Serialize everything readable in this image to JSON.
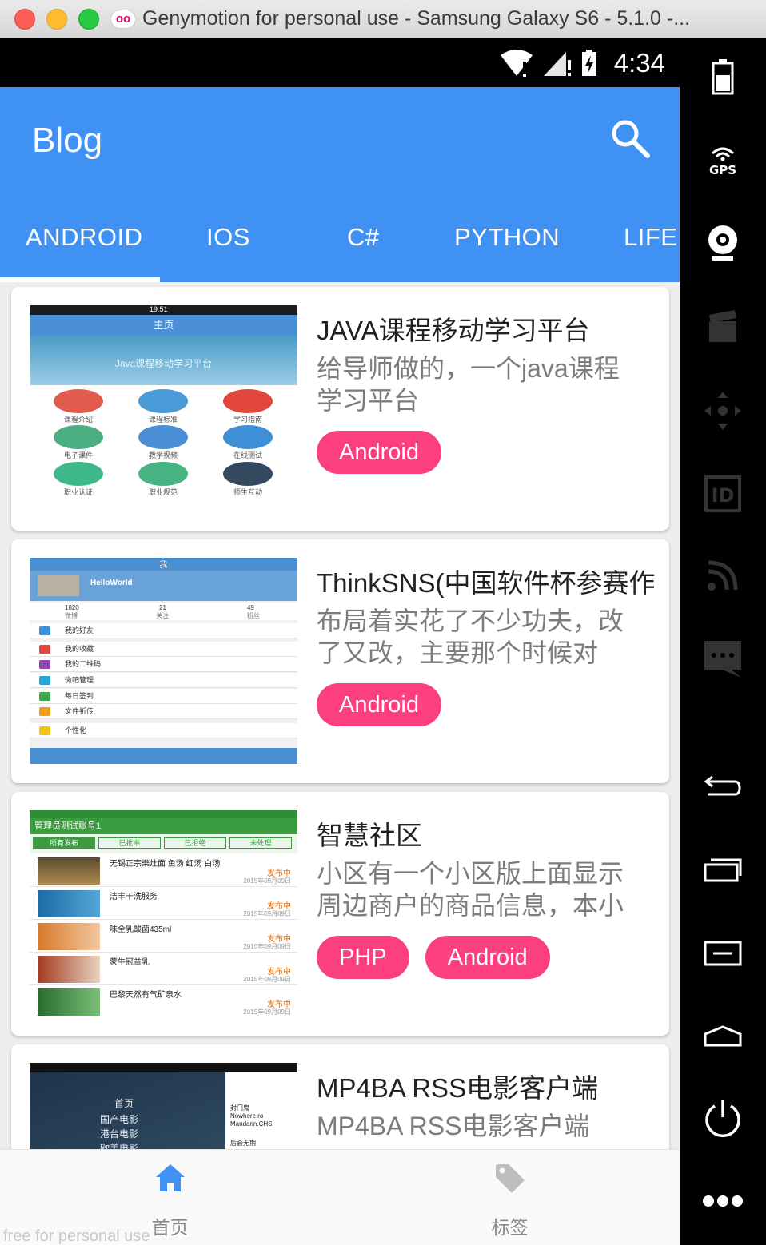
{
  "window": {
    "title": "Genymotion for personal use - Samsung Galaxy S6 - 5.1.0 -..."
  },
  "status_bar": {
    "time": "4:34"
  },
  "app_bar": {
    "title": "Blog"
  },
  "tabs": [
    {
      "label": "ANDROID",
      "selected": true
    },
    {
      "label": "IOS"
    },
    {
      "label": "C#"
    },
    {
      "label": "PYTHON"
    },
    {
      "label": "LIFE"
    }
  ],
  "posts": [
    {
      "title": "JAVA课程移动学习平台",
      "desc": "给导师做的，一个java课程学习平台",
      "tags": [
        "Android"
      ],
      "thumb": {
        "time": "19:51",
        "bar": "主页",
        "banner": "Java课程移动学习平台",
        "items": [
          "课程介绍",
          "课程标准",
          "学习指南",
          "电子课件",
          "教学视频",
          "在线测试",
          "职业认证",
          "职业规范",
          "师生互动"
        ]
      }
    },
    {
      "title": "ThinkSNS(中国软件杯参赛作",
      "desc": "布局着实花了不少功夫，改了又改，主要那个时候对",
      "tags": [
        "Android"
      ],
      "thumb": {
        "top": "我",
        "user": "HelloWorld",
        "stats": [
          "1820",
          "21",
          "49"
        ],
        "stat_labels": [
          "微博",
          "关注",
          "粉丝"
        ],
        "rows": [
          "我的好友",
          "我的收藏",
          "我的二维码",
          "微吧管理",
          "每日签到",
          "文件祈传",
          "个性化"
        ]
      }
    },
    {
      "title": "智慧社区",
      "desc": "小区有一个小区版上面显示周边商户的商品信息，本小",
      "tags": [
        "PHP",
        "Android"
      ],
      "thumb": {
        "bar": "管理员测试账号1",
        "tabs": [
          "所有发布",
          "已批准",
          "已拒绝",
          "未处理"
        ],
        "rows": [
          "无锡正宗樂灶面 鱼汤 红汤 白汤",
          "洁丰干洗服务",
          "味全乳酸菌435ml",
          "蒙牛冠益乳",
          "巴黎天然有气矿泉水"
        ],
        "status": "发布中",
        "date": "2015年09月09日"
      }
    },
    {
      "title": "MP4BA RSS电影客户端",
      "desc": "MP4BA RSS电影客户端",
      "tags": [],
      "thumb": {
        "menu": [
          "首页",
          "国产电影",
          "港台电影",
          "欧美电影"
        ],
        "panel": [
          "封门鬼",
          "Nowhere.ro Mandarin.CHS",
          "后会无期"
        ]
      }
    }
  ],
  "bottom_nav": [
    {
      "label": "首页",
      "icon": "home-icon",
      "active": true
    },
    {
      "label": "标签",
      "icon": "tag-icon",
      "active": false
    }
  ],
  "watermark": "free for personal use",
  "side_bar": [
    "battery-icon",
    "gps-icon",
    "webcam-icon",
    "video-capture-icon",
    "dpad-icon",
    "device-id-icon",
    "network-icon",
    "sms-icon",
    "back-icon",
    "recent-apps-icon",
    "menu-icon",
    "home-button-icon",
    "power-icon",
    "more-icon"
  ],
  "colors": {
    "primary": "#3f92f4",
    "accent": "#fc3f7e",
    "background": "#eeeeee"
  }
}
